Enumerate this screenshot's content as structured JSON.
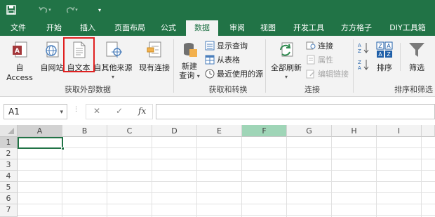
{
  "quick_access": {
    "save_icon": "save-icon",
    "undo_icon": "undo-icon",
    "redo_icon": "redo-icon",
    "customize_icon": "customize-qat-icon"
  },
  "tabs": [
    {
      "label": "文件"
    },
    {
      "label": "开始"
    },
    {
      "label": "插入"
    },
    {
      "label": "页面布局"
    },
    {
      "label": "公式"
    },
    {
      "label": "数据"
    },
    {
      "label": "审阅"
    },
    {
      "label": "视图"
    },
    {
      "label": "开发工具"
    },
    {
      "label": "方方格子"
    },
    {
      "label": "DIY工具箱"
    }
  ],
  "active_tab": "数据",
  "ribbon": {
    "get_external": {
      "group_label": "获取外部数据",
      "access": "自 Access",
      "web": "自网站",
      "text": "自文本",
      "other": "自其他来源",
      "existing": "现有连接"
    },
    "get_transform": {
      "group_label": "获取和转换",
      "new_query_line1": "新建",
      "new_query_line2": "查询",
      "show_queries": "显示查询",
      "from_table": "从表格",
      "recent_sources": "最近使用的源"
    },
    "connections": {
      "group_label": "连接",
      "refresh_all": "全部刷新",
      "connections": "连接",
      "properties": "属性",
      "edit_links": "编辑链接"
    },
    "sort_filter": {
      "group_label": "排序和筛选",
      "sort": "排序",
      "filter": "筛选"
    }
  },
  "formula_bar": {
    "name_box": "A1",
    "cancel_glyph": "✕",
    "enter_glyph": "✓",
    "fx_label": "fx",
    "formula_value": ""
  },
  "grid": {
    "columns": [
      "A",
      "B",
      "C",
      "D",
      "E",
      "F",
      "G",
      "H",
      "I"
    ],
    "rows": [
      "1",
      "2",
      "3",
      "4",
      "5",
      "6",
      "7"
    ],
    "active_cell": "A1",
    "highlighted_column": "F"
  },
  "colors": {
    "excel_green": "#217346",
    "highlight_red": "#e02020",
    "column_highlight": "#9fd5b7"
  }
}
